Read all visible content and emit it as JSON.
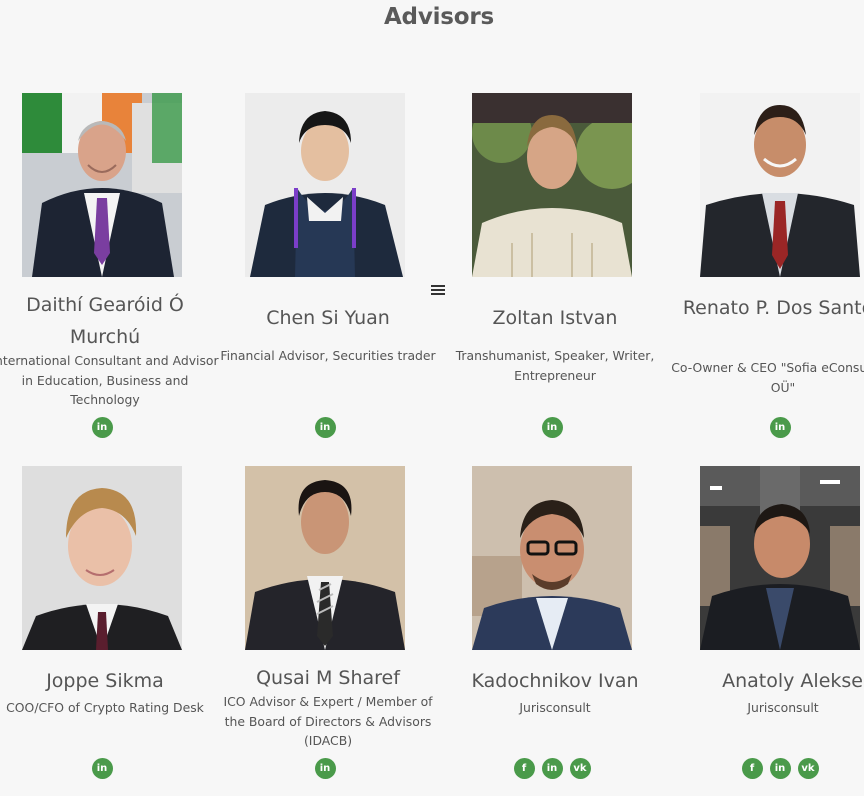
{
  "section": {
    "title": "Advisors"
  },
  "advisors": [
    {
      "name": "Daithí Gearóid Ó Murchú",
      "role": "International Consultant and Advisor in Education, Business and Technology",
      "socials": [
        "linkedin"
      ]
    },
    {
      "name": "Chen Si Yuan",
      "role": "Financial Advisor, Securities trader",
      "socials": [
        "linkedin"
      ]
    },
    {
      "name": "Zoltan Istvan",
      "role": "Transhumanist, Speaker, Writer, Entrepreneur",
      "socials": [
        "linkedin"
      ]
    },
    {
      "name": "Renato P. Dos Santos",
      "role": "Co-Owner & CEO \"Sofia eConsulting OÜ\"",
      "socials": [
        "linkedin"
      ]
    },
    {
      "name": "Joppe Sikma",
      "role": "COO/CFO of Crypto Rating Desk",
      "socials": [
        "linkedin"
      ]
    },
    {
      "name": "Qusai M Sharef",
      "role": "ICO Advisor & Expert / Member of the Board of Directors & Advisors (IDACB)",
      "socials": [
        "linkedin"
      ]
    },
    {
      "name": "Kadochnikov Ivan",
      "role": "Jurisconsult",
      "socials": [
        "facebook",
        "linkedin",
        "vk"
      ]
    },
    {
      "name": "Anatoly Alekseev",
      "role": "Jurisconsult",
      "socials": [
        "facebook",
        "linkedin",
        "vk"
      ]
    }
  ],
  "social_glyphs": {
    "linkedin": "in",
    "facebook": "f",
    "vk": "vk"
  },
  "colors": {
    "accent": "#4a9a4a",
    "background": "#f7f7f7",
    "text": "#555555"
  }
}
